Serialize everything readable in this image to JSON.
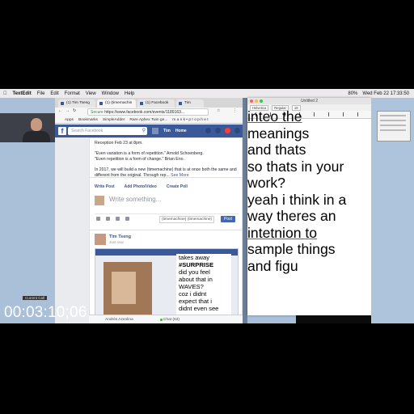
{
  "menubar": {
    "app": "TextEdit",
    "items": [
      "File",
      "Edit",
      "Format",
      "View",
      "Window",
      "Help"
    ],
    "clock": "Wed Feb 22 17:33:50",
    "battery": "80%"
  },
  "browser": {
    "tabs": [
      "(1) Tim Tseng",
      "(1) (timemachin",
      "(1) Facebook",
      "Tim"
    ],
    "url_secure": "Secure",
    "url": "https://www.facebook.com/events/1189163...",
    "bookmarks": [
      "Apps",
      "Bookmarks",
      "SimpleAdder",
      "Rare Aphex Twin ge...",
      "m a n k • p r o p h e t"
    ]
  },
  "facebook": {
    "logo": "f",
    "search_placeholder": "Search Facebook",
    "user": "Tim",
    "home": "Home",
    "post1": {
      "line1": "Reception Feb 23 at 8pm.",
      "quote1": "\"Even variation is a form of repetition.\" Arnold Schoenberg.",
      "quote2": "\"Even repetition is a form of change.\" Brian Eno.",
      "body": "In 2017, we will build a new (timemachine) that is at once both the same and different from the original. Through rep...",
      "see_more": "See More"
    },
    "composer": {
      "write_post": "Write Post",
      "add_photo": "Add Photo/Video",
      "create_poll": "Create Poll",
      "placeholder": "Write something...",
      "audience": "(timemachine) (timemachine)",
      "post_button": "Post"
    },
    "post2": {
      "author": "Tim Tseng",
      "time": "Just now",
      "overlay_lines": [
        "takes away",
        "#SURPRISE",
        "did you feel",
        "about that in",
        "WAVES?",
        "coz i didnt",
        "expect that i",
        "didnt even see"
      ]
    },
    "chat": {
      "person": "Andrés Azeolina",
      "label": "Chat (63)"
    }
  },
  "textedit": {
    "title": "Untitled 2",
    "toolbar": [
      "Helvetica",
      "Regular",
      "18"
    ],
    "lines": [
      {
        "text": "inteo the",
        "misspelled": true
      },
      {
        "text": "meanings",
        "misspelled": false
      },
      {
        "text": "and thats",
        "misspelled": false
      },
      {
        "text": "so thats in your",
        "misspelled": false
      },
      {
        "text": "work?",
        "misspelled": false
      },
      {
        "text": "yeah i think in a",
        "misspelled": false
      },
      {
        "text": "way theres an",
        "misspelled": false
      },
      {
        "text": "intetnion to",
        "misspelled": true
      },
      {
        "text": "sample things",
        "misspelled": false
      },
      {
        "text": "and figu",
        "misspelled": false
      }
    ]
  },
  "webcam": {
    "label": "Current Call"
  },
  "timecode": "00:03:10;06"
}
